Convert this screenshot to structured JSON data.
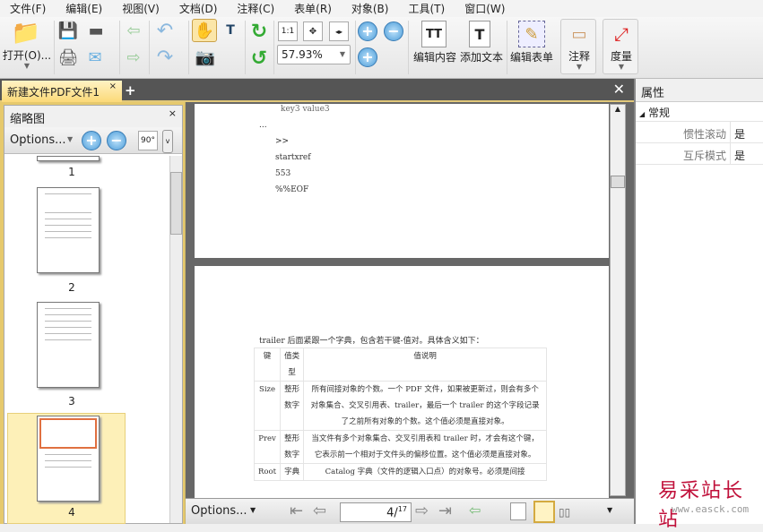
{
  "menu": [
    "文件(F)",
    "编辑(E)",
    "视图(V)",
    "文档(D)",
    "注释(C)",
    "表单(R)",
    "对象(B)",
    "工具(T)",
    "窗口(W)"
  ],
  "toolbar": {
    "open_label": "打开(O)...",
    "zoom_value": "57.93%",
    "fit_1_1": "1:1",
    "edit_content": "编辑内容",
    "add_text": "添加文本",
    "edit_form": "编辑表单",
    "annotate": "注释",
    "measure": "度量"
  },
  "tab": {
    "title": "新建文件PDF文件1",
    "close": "×",
    "new": "+"
  },
  "thumbs": {
    "title": "缩略图",
    "close": "×",
    "options": "Options...",
    "rotate": "90°",
    "pages": [
      "1",
      "2",
      "3",
      "4"
    ]
  },
  "page3": {
    "lines": [
      "key3    value3",
      "...",
      ">>",
      "startxref",
      "553",
      "%%EOF"
    ]
  },
  "page4": {
    "intro": "trailer 后面紧跟一个字典，包含若干键-值对。具体含义如下：",
    "headers": [
      "键",
      "值类型",
      "值说明"
    ],
    "rows": [
      {
        "key": "Size",
        "type": "整形数字",
        "desc": "所有间接对象的个数。一个 PDF 文件，如果被更新过，则会有多个对象集合、交叉引用表、trailer，最后一个 trailer 的这个字段记录了之前所有对象的个数。这个值必须是直接对象。"
      },
      {
        "key": "Prev",
        "type": "整形数字",
        "desc": "当文件有多个对象集合、交叉引用表和 trailer 时，才会有这个键，它表示前一个相对于文件头的偏移位置。这个值必须是直接对象。"
      },
      {
        "key": "Root",
        "type": "字典",
        "desc": "Catalog 字典（文件的逻辑入口点）的对象号。必须是间接"
      }
    ]
  },
  "nav": {
    "options": "Options...",
    "current_page": "4",
    "total_pages": "17"
  },
  "properties": {
    "title": "属性",
    "group": "常规",
    "items": [
      {
        "key": "惯性滚动",
        "value": "是"
      },
      {
        "key": "互斥模式",
        "value": "是"
      }
    ]
  },
  "watermark": {
    "cn": "易采站长站",
    "url": "www.easck.com"
  }
}
